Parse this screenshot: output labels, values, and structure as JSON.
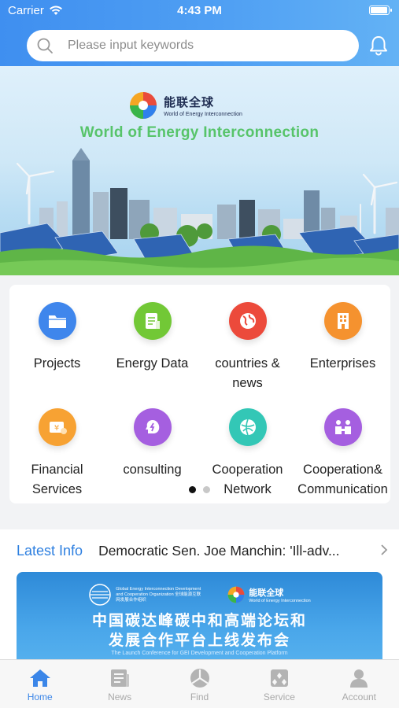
{
  "status_bar": {
    "carrier": "Carrier",
    "time": "4:43 PM",
    "battery_level": 1.0
  },
  "search": {
    "placeholder": "Please input keywords",
    "value": ""
  },
  "banner": {
    "logo_cn": "能联全球",
    "logo_en": "World of Energy Interconnection",
    "title": "World of Energy Interconnection"
  },
  "categories": [
    {
      "label": "Projects",
      "icon": "folder-icon",
      "color": "#3f86ec"
    },
    {
      "label": "Energy Data",
      "icon": "document-icon",
      "color": "#72c836"
    },
    {
      "label": "countries & news",
      "icon": "globe-icon",
      "color": "#ec4a3b"
    },
    {
      "label": "Enterprises",
      "icon": "building-icon",
      "color": "#f5922f"
    },
    {
      "label": "Financial Services",
      "icon": "money-icon",
      "color": "#f7a233"
    },
    {
      "label": "consulting",
      "icon": "brain-icon",
      "color": "#a55fe0"
    },
    {
      "label": "Cooperation Network",
      "icon": "network-icon",
      "color": "#33c7b6"
    },
    {
      "label": "Cooperation& Communication",
      "icon": "communication-icon",
      "color": "#a55fe0"
    }
  ],
  "pager": {
    "pages": 2,
    "current": 1
  },
  "latest_info": {
    "label": "Latest Info",
    "headline": "Democratic Sen. Joe Manchin: 'Ill-adv..."
  },
  "news_card": {
    "org_text": "Global Energy Interconnection Development and Cooperation Organization 全球能源互联网发展合作组织",
    "logo_cn": "能联全球",
    "logo_en": "World of Energy Interconnection",
    "title_line1": "中国碳达峰碳中和高端论坛和",
    "title_line2": "发展合作平台上线发布会",
    "subtitle": "The Launch Conference for GEI Development and Cooperation Platform"
  },
  "tabs": [
    {
      "label": "Home",
      "icon": "home-icon",
      "active": true
    },
    {
      "label": "News",
      "icon": "news-icon",
      "active": false
    },
    {
      "label": "Find",
      "icon": "find-icon",
      "active": false
    },
    {
      "label": "Service",
      "icon": "service-icon",
      "active": false
    },
    {
      "label": "Account",
      "icon": "account-icon",
      "active": false
    }
  ],
  "colors": {
    "accent": "#3b86e8",
    "header": "#4a99f2",
    "banner_title": "#57c46a"
  }
}
